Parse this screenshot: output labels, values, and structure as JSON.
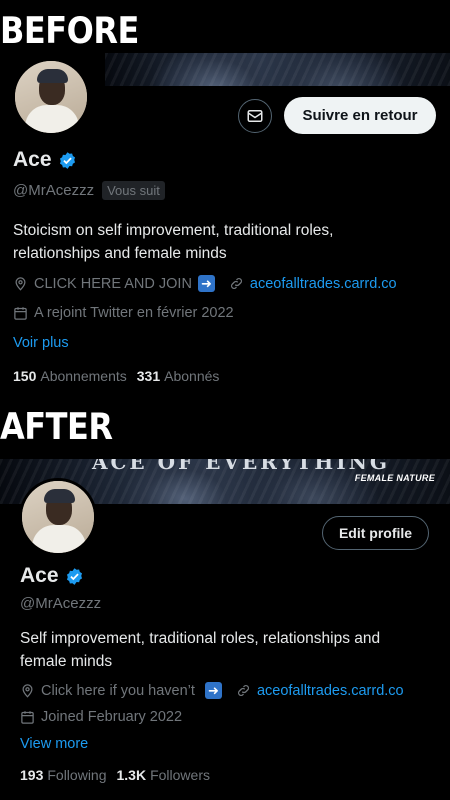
{
  "before": {
    "section_title": "BEFORE",
    "follow_back_label": "Suivre en retour",
    "name": "Ace",
    "handle": "@MrAcezzz",
    "follows_you": "Vous suit",
    "bio": "Stoicism on self improvement, traditional roles, relationships and female minds",
    "promo_text": "CLICK HERE AND JOIN",
    "website": "aceofalltrades.carrd.co",
    "joined": "A rejoint Twitter en février 2022",
    "see_more": "Voir plus",
    "following_count": "150",
    "following_label": "Abonnements",
    "followers_count": "331",
    "followers_label": "Abonnés"
  },
  "after": {
    "section_title": "AFTER",
    "banner_caption": "ACE OF EVERYTHING",
    "banner_tag": "FEMALE NATURE",
    "edit_profile_label": "Edit profile",
    "name": "Ace",
    "handle": "@MrAcezzz",
    "bio": "Self improvement, traditional roles, relationships and female minds",
    "promo_text": "Click here if you haven’t",
    "website": "aceofalltrades.carrd.co",
    "joined": "Joined February 2022",
    "see_more": "View more",
    "following_count": "193",
    "following_label": "Following",
    "followers_count": "1.3K",
    "followers_label": "Followers"
  },
  "colors": {
    "background": "#000000",
    "accent_blue": "#1d9bf0",
    "muted_text": "#71767b",
    "primary_text": "#e7e9ea"
  },
  "icons": [
    "mail-icon",
    "verified-badge-icon",
    "location-icon",
    "arrow-right-emoji-icon",
    "link-icon",
    "calendar-icon"
  ]
}
